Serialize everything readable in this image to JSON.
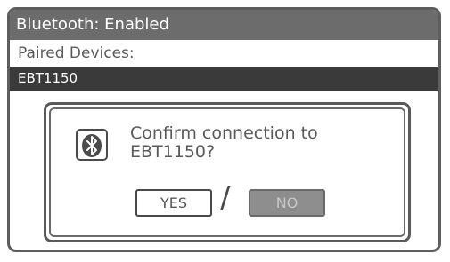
{
  "window": {
    "title": "Bluetooth: Enabled"
  },
  "paired_devices": {
    "label": "Paired Devices:",
    "items": [
      {
        "name": "EBT1150",
        "selected": true
      }
    ]
  },
  "dialog": {
    "icon": "bluetooth-icon",
    "message_line1": "Confirm connection to",
    "message_line2": "EBT1150?",
    "yes_label": "YES",
    "separator": "/",
    "no_label": "NO"
  },
  "colors": {
    "titlebar": "#6c6c6c",
    "selected_row": "#3a3a3a",
    "disabled_button": "#8e8e8e"
  }
}
